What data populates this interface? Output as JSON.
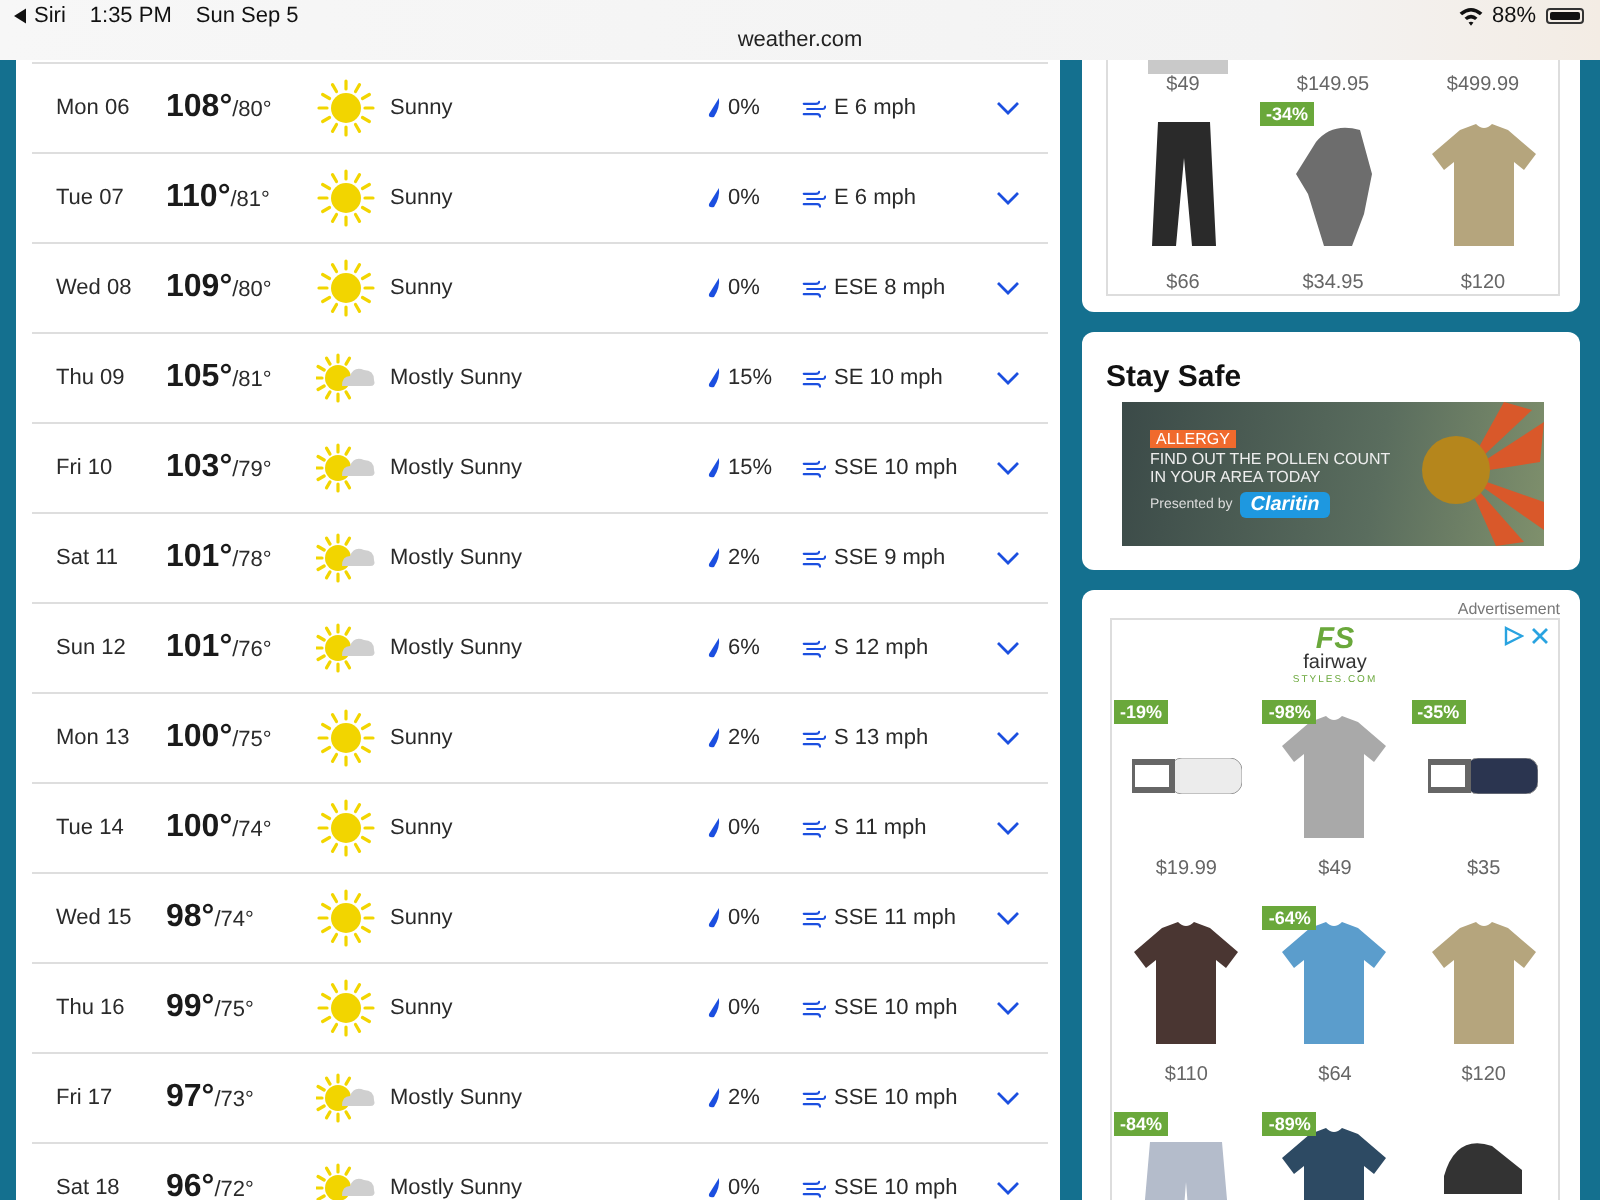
{
  "status_bar": {
    "back_label": "Siri",
    "time": "1:35 PM",
    "date": "Sun Sep 5",
    "url": "weather.com",
    "battery": "88%"
  },
  "forecast": [
    {
      "day": "Mon 06",
      "high": "108°",
      "low": "/80°",
      "kind": "sunny",
      "condition": "Sunny",
      "precip": "0%",
      "wind": "E 6 mph"
    },
    {
      "day": "Tue 07",
      "high": "110°",
      "low": "/81°",
      "kind": "sunny",
      "condition": "Sunny",
      "precip": "0%",
      "wind": "E 6 mph"
    },
    {
      "day": "Wed 08",
      "high": "109°",
      "low": "/80°",
      "kind": "sunny",
      "condition": "Sunny",
      "precip": "0%",
      "wind": "ESE 8 mph"
    },
    {
      "day": "Thu 09",
      "high": "105°",
      "low": "/81°",
      "kind": "partly",
      "condition": "Mostly Sunny",
      "precip": "15%",
      "wind": "SE 10 mph"
    },
    {
      "day": "Fri 10",
      "high": "103°",
      "low": "/79°",
      "kind": "partly",
      "condition": "Mostly Sunny",
      "precip": "15%",
      "wind": "SSE 10 mph"
    },
    {
      "day": "Sat 11",
      "high": "101°",
      "low": "/78°",
      "kind": "partly",
      "condition": "Mostly Sunny",
      "precip": "2%",
      "wind": "SSE 9 mph"
    },
    {
      "day": "Sun 12",
      "high": "101°",
      "low": "/76°",
      "kind": "partly",
      "condition": "Mostly Sunny",
      "precip": "6%",
      "wind": "S 12 mph"
    },
    {
      "day": "Mon 13",
      "high": "100°",
      "low": "/75°",
      "kind": "sunny",
      "condition": "Sunny",
      "precip": "2%",
      "wind": "S 13 mph"
    },
    {
      "day": "Tue 14",
      "high": "100°",
      "low": "/74°",
      "kind": "sunny",
      "condition": "Sunny",
      "precip": "0%",
      "wind": "S 11 mph"
    },
    {
      "day": "Wed 15",
      "high": "98°",
      "low": "/74°",
      "kind": "sunny",
      "condition": "Sunny",
      "precip": "0%",
      "wind": "SSE 11 mph"
    },
    {
      "day": "Thu 16",
      "high": "99°",
      "low": "/75°",
      "kind": "sunny",
      "condition": "Sunny",
      "precip": "0%",
      "wind": "SSE 10 mph"
    },
    {
      "day": "Fri 17",
      "high": "97°",
      "low": "/73°",
      "kind": "partly",
      "condition": "Mostly Sunny",
      "precip": "2%",
      "wind": "SSE 10 mph"
    },
    {
      "day": "Sat 18",
      "high": "96°",
      "low": "/72°",
      "kind": "partly",
      "condition": "Mostly Sunny",
      "precip": "0%",
      "wind": "SSE 10 mph"
    }
  ],
  "top_ad": {
    "prices": [
      "$49",
      "$149.95",
      "$499.99"
    ],
    "products": [
      {
        "kind": "pants",
        "price": "$66"
      },
      {
        "kind": "glove",
        "badge": "-34%",
        "price": "$34.95"
      },
      {
        "kind": "hoodie",
        "price": "$120"
      }
    ]
  },
  "stay_safe": {
    "title": "Stay Safe",
    "banner": {
      "tag": "ALLERGY",
      "headline": "FIND OUT THE POLLEN COUNT IN YOUR AREA TODAY",
      "presented_by": "Presented by",
      "brand": "Claritin"
    }
  },
  "fairway_ad": {
    "label": "Advertisement",
    "logo_mark": "FS",
    "logo_name": "fairway",
    "logo_sub": "STYLES.COM",
    "products": [
      {
        "kind": "belt-white",
        "badge": "-19%",
        "price": "$19.99"
      },
      {
        "kind": "polo-grey",
        "badge": "-98%",
        "price": "$49"
      },
      {
        "kind": "belt-navy",
        "badge": "-35%",
        "price": "$35"
      },
      {
        "kind": "polo-brown",
        "price": "$110"
      },
      {
        "kind": "polo-blue",
        "badge": "-64%",
        "price": "$64"
      },
      {
        "kind": "hoodie",
        "price": "$120"
      },
      {
        "kind": "shorts",
        "badge": "-84%"
      },
      {
        "kind": "polo-navy",
        "badge": "-89%"
      },
      {
        "kind": "shoes"
      }
    ]
  }
}
